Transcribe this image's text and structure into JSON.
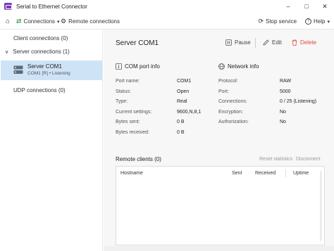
{
  "window": {
    "title": "Serial to Ethernet Connector",
    "minimize": "–",
    "maximize": "□",
    "close": "✕"
  },
  "toolbar": {
    "home_icon": "⌂",
    "connections_icon": "⇄",
    "connections_label": "Connections",
    "connections_chevron": "▾",
    "remote_icon": "⚙",
    "remote_label": "Remote connections",
    "stop_icon": "⟳",
    "stop_label": "Stop service",
    "help_icon": "?",
    "help_label": "Help",
    "help_chevron": "▾"
  },
  "sidebar": {
    "client_connections": "Client connections (0)",
    "server_connections_chevron": "∨",
    "server_connections": "Server connections (1)",
    "server_item": {
      "title": "Server COM1",
      "subtitle": "COM1 [R] • Listening"
    },
    "udp_connections": "UDP connections (0)"
  },
  "main": {
    "title": "Server COM1",
    "pause_label": "Pause",
    "edit_label": "Edit",
    "delete_label": "Delete",
    "com_section": "COM port info",
    "network_section": "Network info",
    "com_rows": [
      {
        "label": "Port name:",
        "value": "COM1"
      },
      {
        "label": "Status:",
        "value": "Open"
      },
      {
        "label": "Type:",
        "value": "Real"
      },
      {
        "label": "Current settings:",
        "value": "9600,N,8,1"
      },
      {
        "label": "Bytes sent:",
        "value": "0 B"
      },
      {
        "label": "Bytes received:",
        "value": "0 B"
      }
    ],
    "network_rows": [
      {
        "label": "Protocol:",
        "value": "RAW"
      },
      {
        "label": "Port:",
        "value": "5000"
      },
      {
        "label": "Connections:",
        "value": "0 / 25 (Listening)"
      },
      {
        "label": "Encryption:",
        "value": "No"
      },
      {
        "label": "Authorization:",
        "value": "No"
      }
    ],
    "remote_clients": "Remote clients (0)",
    "reset_statistics": "Reset statistics",
    "disconnect": "Disconnect",
    "table_headers": {
      "hostname": "Hostname",
      "sent": "Sent",
      "received": "Received",
      "uptime": "Uptime"
    }
  },
  "colors": {
    "accent": "#7a3bb8",
    "selection": "#cfe3f7",
    "delete": "#e0483e",
    "server_icon": "#5a6b7d"
  }
}
